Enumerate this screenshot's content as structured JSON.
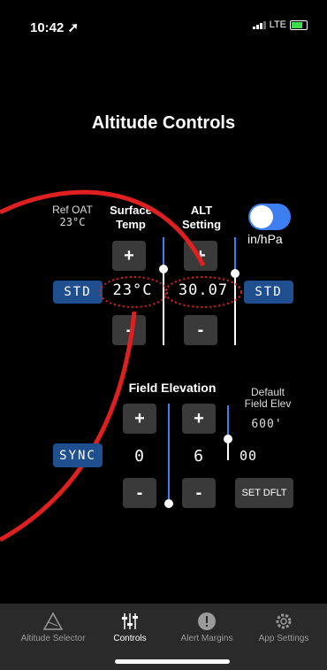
{
  "status": {
    "time": "10:42",
    "network": "LTE"
  },
  "title": "Altitude Controls",
  "ref_oat": {
    "label": "Ref OAT",
    "value": "23°C"
  },
  "surface_temp": {
    "label_1": "Surface",
    "label_2": "Temp",
    "value": "23°C",
    "plus": "+",
    "minus": "-"
  },
  "alt_setting": {
    "label_1": "ALT",
    "label_2": "Setting",
    "value": "30.07",
    "plus": "+",
    "minus": "-"
  },
  "units_toggle": {
    "label": "in/hPa",
    "on": true
  },
  "std_left": "STD",
  "std_right": "STD",
  "field_elevation": {
    "label": "Field Elevation",
    "sync": "SYNC",
    "digit_thousands": "0",
    "digit_hundreds": "6",
    "digit_tens": "00",
    "plus": "+",
    "minus": "-",
    "set_default": "SET DFLT"
  },
  "default_field_elev": {
    "label_1": "Default",
    "label_2": "Field Elev",
    "value": "600'"
  },
  "tabs": [
    {
      "label": "Altitude Selector",
      "icon": "altitude-selector-icon",
      "active": false
    },
    {
      "label": "Controls",
      "icon": "sliders-icon",
      "active": true
    },
    {
      "label": "Alert Margins",
      "icon": "alert-icon",
      "active": false
    },
    {
      "label": "App Settings",
      "icon": "gear-icon",
      "active": false
    }
  ],
  "colors": {
    "accent_blue": "#3d7ff0",
    "std_blue": "#1f4f8f",
    "annotation_red": "#e02020",
    "tab_bg": "#2a2a2a"
  }
}
